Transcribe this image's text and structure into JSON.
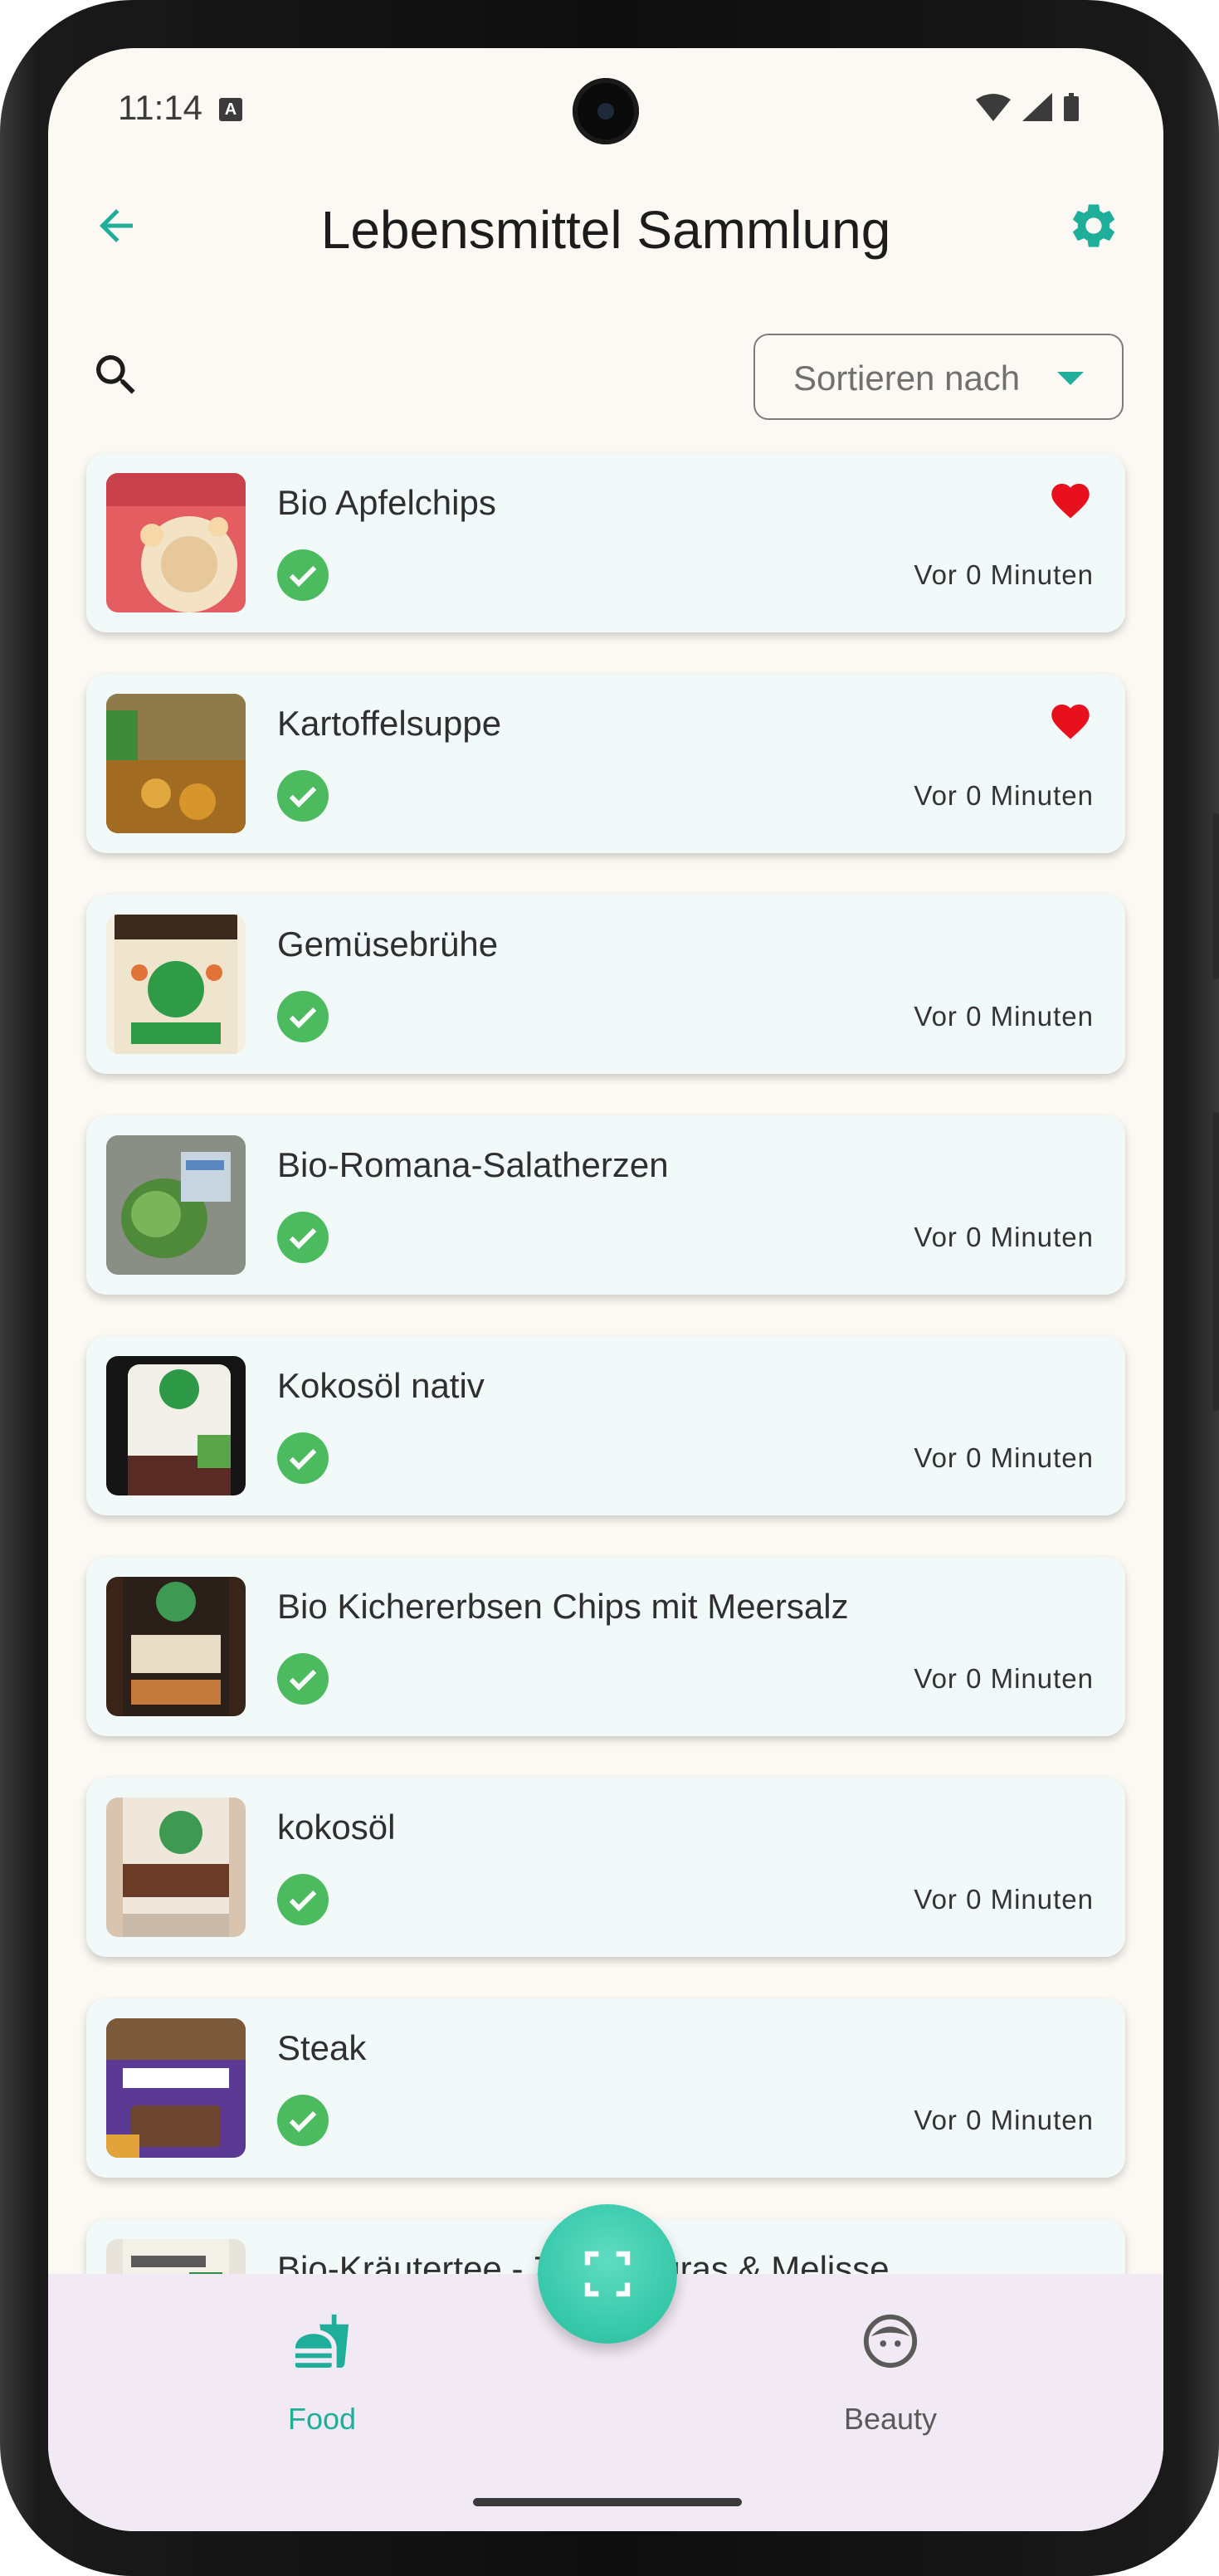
{
  "status_bar": {
    "time": "11:14",
    "indicator": "A",
    "icons": [
      "wifi-icon",
      "signal-icon",
      "battery-icon"
    ]
  },
  "appbar": {
    "title": "Lebensmittel Sammlung",
    "back_icon": "arrow-left-icon",
    "settings_icon": "gear-icon"
  },
  "toolbar": {
    "search_icon": "search-icon",
    "sort_label": "Sortieren nach"
  },
  "items": [
    {
      "name": "Bio Apfelchips",
      "time": "Vor 0 Minuten",
      "favorite": true
    },
    {
      "name": "Kartoffelsuppe",
      "time": "Vor 0 Minuten",
      "favorite": true
    },
    {
      "name": "Gemüsebrühe",
      "time": "Vor 0 Minuten",
      "favorite": false
    },
    {
      "name": "Bio-Romana-Salatherzen",
      "time": "Vor 0 Minuten",
      "favorite": false
    },
    {
      "name": "Kokosöl nativ",
      "time": "Vor 0 Minuten",
      "favorite": false
    },
    {
      "name": "Bio Kichererbsen Chips mit Meersalz",
      "time": "Vor 0 Minuten",
      "favorite": false
    },
    {
      "name": "kokosöl",
      "time": "Vor 0 Minuten",
      "favorite": false
    },
    {
      "name": "Steak",
      "time": "Vor 0 Minuten",
      "favorite": false
    },
    {
      "name": "Bio-Kräutertee - Zitronengras & Melisse",
      "time": "",
      "favorite": false
    }
  ],
  "bottom_nav": {
    "food_label": "Food",
    "beauty_label": "Beauty",
    "active": "Food"
  },
  "fab": {
    "icon": "scan-icon"
  },
  "colors": {
    "accent": "#1fae9a",
    "heart": "#e8101c",
    "check": "#4cba5f",
    "card_bg": "#f1faf8",
    "background": "#fcf8f3",
    "nav_bg": "#f1e9f3"
  }
}
